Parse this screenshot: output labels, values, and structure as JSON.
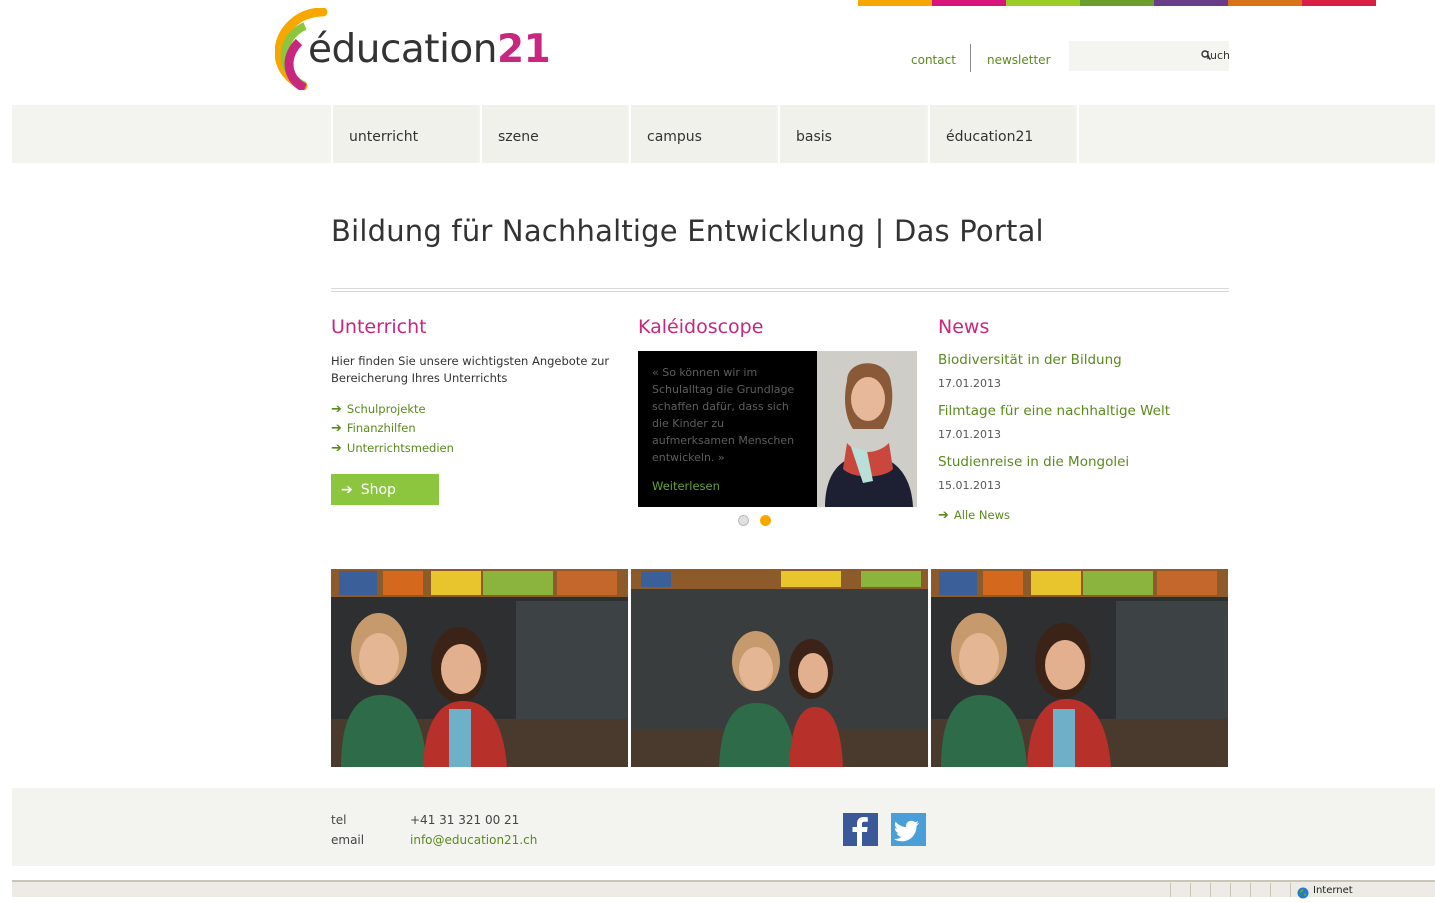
{
  "colors": {
    "accent": "#c8267f",
    "green": "#5a8a1c",
    "shop_green": "#8cc63f",
    "strip": [
      "#f7a800",
      "#d8157a",
      "#9ccc2a",
      "#6b9e2c",
      "#6a3d88",
      "#d9731a",
      "#d81f45"
    ]
  },
  "logo": {
    "prefix": "éducation",
    "suffix": "21"
  },
  "header": {
    "contact_label": "contact",
    "newsletter_label": "newsletter",
    "search_placeholder": "",
    "search_button": "Such"
  },
  "nav": {
    "items": [
      {
        "label": "unterricht"
      },
      {
        "label": "szene"
      },
      {
        "label": "campus"
      },
      {
        "label": "basis"
      },
      {
        "label": "éducation21"
      }
    ]
  },
  "page": {
    "title": "Bildung für Nachhaltige Entwicklung | Das Portal"
  },
  "unterricht": {
    "heading": "Unterricht",
    "intro": "Hier finden Sie unsere wichtigsten Angebote zur Bereicherung Ihres Unterrichts",
    "links": [
      "Schulprojekte",
      "Finanzhilfen",
      "Unterrichtsmedien"
    ],
    "shop_label": "Shop"
  },
  "kaleidoscope": {
    "heading": "Kaléidoscope",
    "quote": "« So können wir im Schulalltag die Grundlage schaffen dafür, dass sich die Kinder zu aufmerksamen Menschen entwickeln. »",
    "read_more": "Weiterlesen",
    "active_slide": 2,
    "slide_count": 2
  },
  "news": {
    "heading": "News",
    "items": [
      {
        "title": "Biodiversität in der Bildung",
        "date": "17.01.2013"
      },
      {
        "title": "Filmtage für eine nachhaltige Welt",
        "date": "17.01.2013"
      },
      {
        "title": "Studienreise in die Mongolei",
        "date": "15.01.2013"
      }
    ],
    "all_news": "Alle News"
  },
  "footer": {
    "tel_label": "tel",
    "tel_value": "+41 31 321 00 21",
    "email_label": "email",
    "email_value": "info@education21.ch"
  },
  "statusbar": {
    "zone": "Internet"
  },
  "icons": {
    "arrow": "arrow-right-icon",
    "search": "search-icon",
    "facebook": "facebook-icon",
    "twitter": "twitter-icon",
    "globe": "globe-icon"
  }
}
